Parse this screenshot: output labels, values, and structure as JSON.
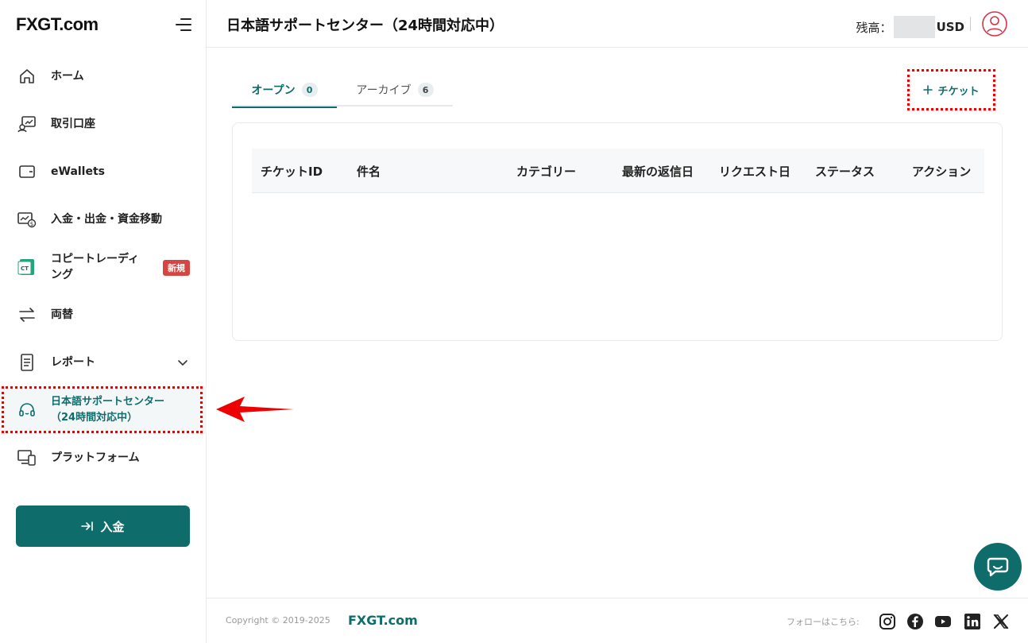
{
  "brand": {
    "logo_left": "FX",
    "logo_mid": "GT",
    "logo_right": ".com"
  },
  "sidebar": {
    "items": [
      {
        "label": "ホーム",
        "icon": "home-icon"
      },
      {
        "label": "取引口座",
        "icon": "trading-account-icon"
      },
      {
        "label": "eWallets",
        "icon": "wallet-icon"
      },
      {
        "label": "入金・出金・資金移動",
        "icon": "funds-transfer-icon"
      },
      {
        "label": "コピートレーディング",
        "icon": "copy-trading-icon",
        "badge": "新規"
      },
      {
        "label": "両替",
        "icon": "exchange-icon"
      },
      {
        "label": "レポート",
        "icon": "report-icon"
      },
      {
        "label": "日本語サポートセンター（24時間対応中）",
        "icon": "headset-icon"
      },
      {
        "label": "プラットフォーム",
        "icon": "platform-icon"
      }
    ],
    "deposit_label": "入金"
  },
  "header": {
    "title": "日本語サポートセンター（24時間対応中）",
    "balance_label": "残高：",
    "currency": "USD"
  },
  "tabs": [
    {
      "label": "オープン",
      "count": "0"
    },
    {
      "label": "アーカイブ",
      "count": "6"
    }
  ],
  "new_ticket_label": "チケット",
  "table": {
    "columns": [
      "チケットID",
      "件名",
      "カテゴリー",
      "最新の返信日",
      "リクエスト日",
      "ステータス",
      "アクション"
    ]
  },
  "footer": {
    "copyright": "Copyright © 2019-2025",
    "brand": "FXGT.com",
    "follow_label": "フォローはこちら:"
  },
  "colors": {
    "accent": "#0e6d6b",
    "highlight": "#e00000",
    "badge": "#d64541"
  }
}
